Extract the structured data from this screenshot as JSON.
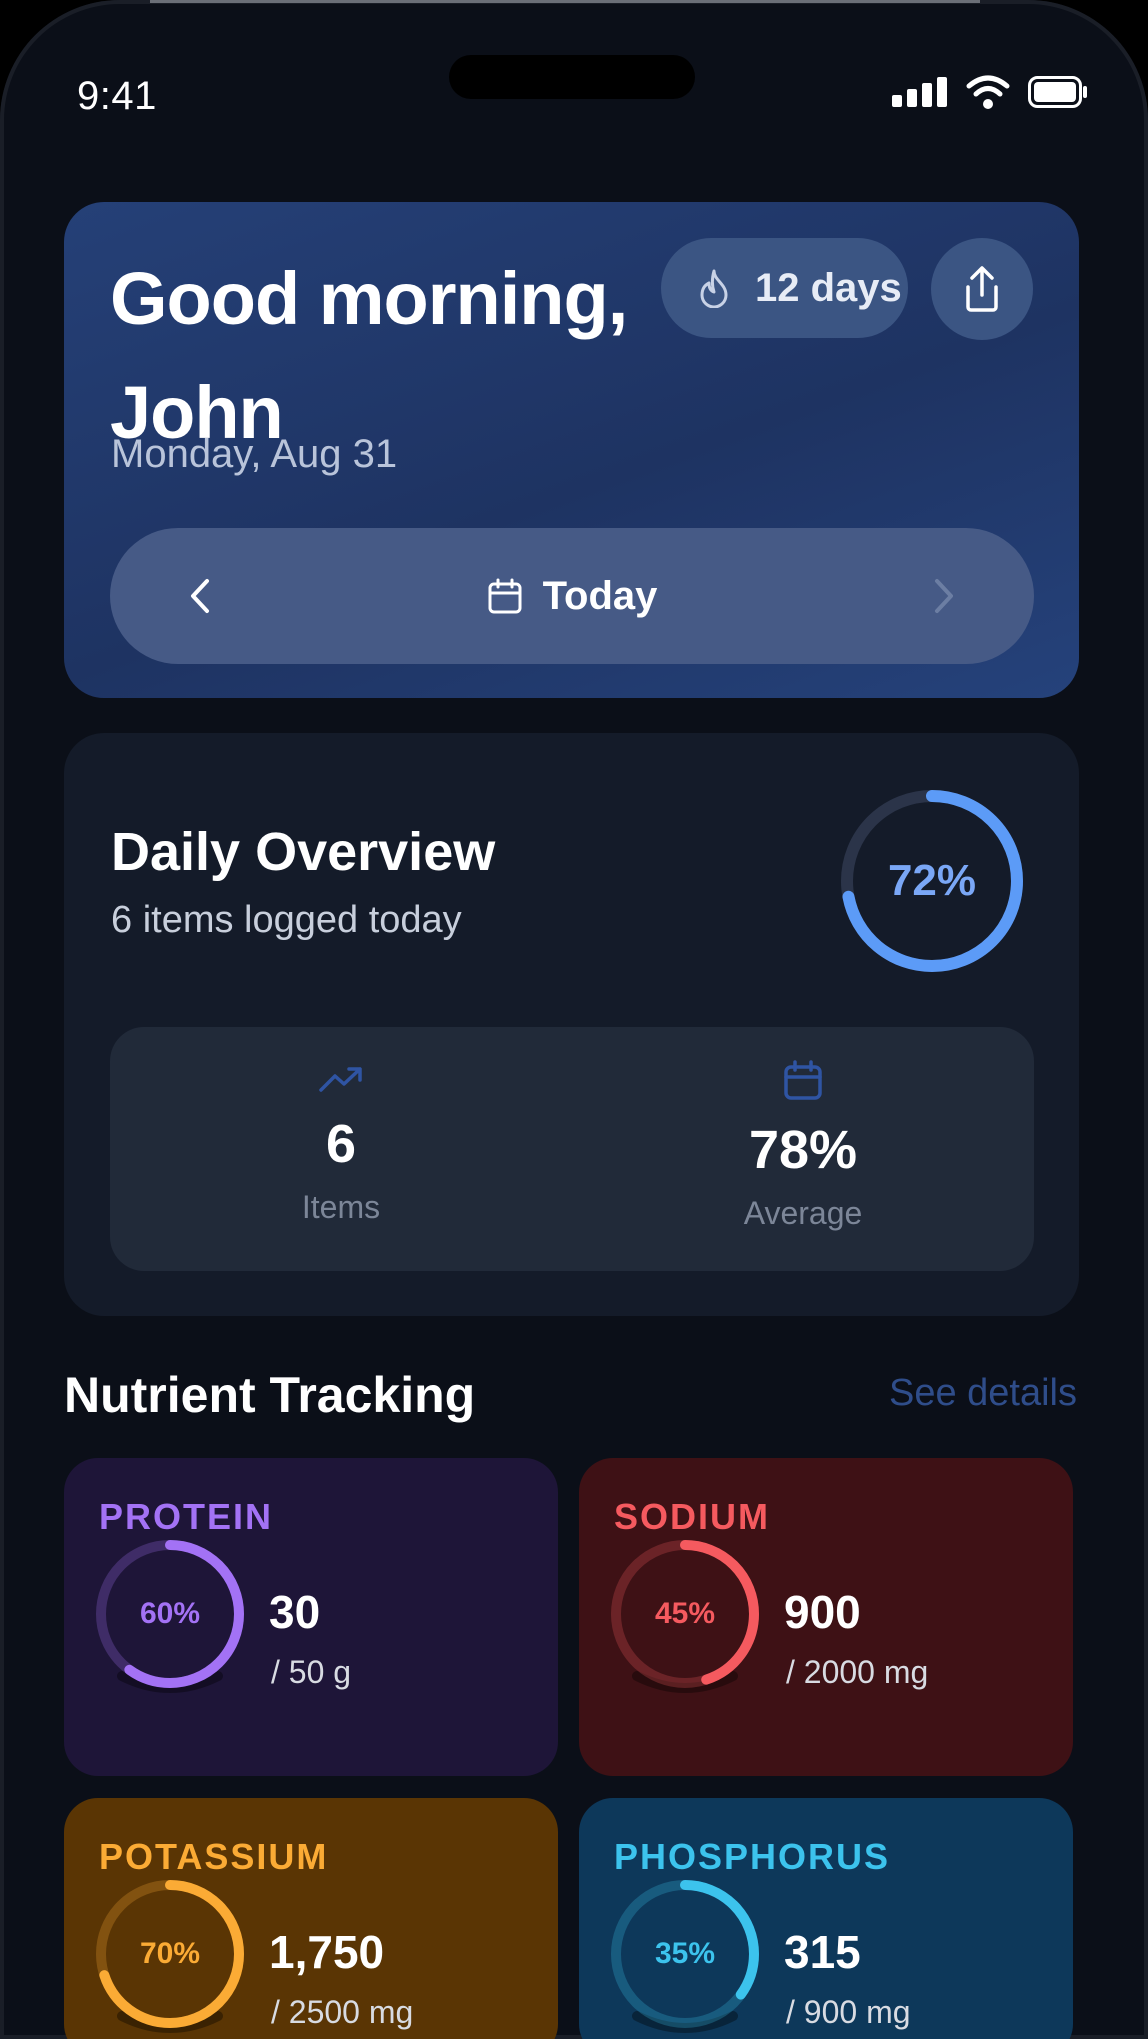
{
  "status_bar": {
    "time": "9:41"
  },
  "hero": {
    "greeting": "Good morning, John",
    "date": "Monday, Aug 31",
    "streak_label": "12 days",
    "nav_label": "Today"
  },
  "overview": {
    "title": "Daily Overview",
    "subtitle": "6 items logged today",
    "progress_label": "72%",
    "progress": 0.72,
    "stats": [
      {
        "value": "6",
        "label": "Items",
        "icon": "trending-up-icon"
      },
      {
        "value": "78%",
        "label": "Average",
        "icon": "calendar-icon"
      }
    ]
  },
  "nutrients": {
    "title": "Nutrient Tracking",
    "link": "See details",
    "items": [
      {
        "name": "PROTEIN",
        "percent_label": "60%",
        "progress": 0.6,
        "value": "30",
        "target": "/ 50 g",
        "accent": "#a372f5",
        "bg": "#1e1538"
      },
      {
        "name": "SODIUM",
        "percent_label": "45%",
        "progress": 0.45,
        "value": "900",
        "target": "/ 2000 mg",
        "accent": "#f55a5f",
        "bg": "#3e1115"
      },
      {
        "name": "POTASSIUM",
        "percent_label": "70%",
        "progress": 0.7,
        "value": "1,750",
        "target": "/ 2500 mg",
        "accent": "#fbab35",
        "bg": "#5a3504"
      },
      {
        "name": "PHOSPHORUS",
        "percent_label": "35%",
        "progress": 0.35,
        "value": "315",
        "target": "/ 900 mg",
        "accent": "#3cc3ed",
        "bg": "#0d385a"
      }
    ]
  },
  "colors": {
    "accent_blue": "#5c9bf7",
    "background": "#0b0f18"
  }
}
